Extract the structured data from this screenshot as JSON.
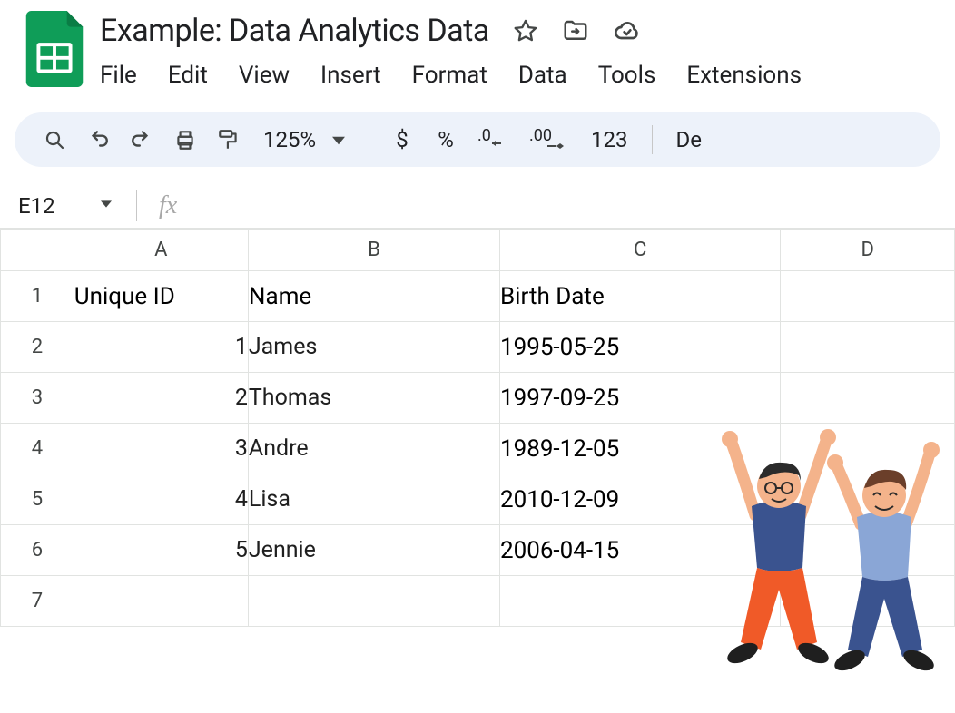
{
  "doc": {
    "title": "Example: Data Analytics Data"
  },
  "menu": [
    "File",
    "Edit",
    "View",
    "Insert",
    "Format",
    "Data",
    "Tools",
    "Extensions"
  ],
  "toolbar": {
    "zoom": "125%",
    "currency": "$",
    "percent": "%",
    "dec_dec": ".0",
    "inc_dec": ".00",
    "num_fmt": "123",
    "font_label": "De"
  },
  "namebox": {
    "cell_ref": "E12",
    "fx": "fx"
  },
  "columns": [
    "A",
    "B",
    "C",
    "D"
  ],
  "row_labels": [
    "1",
    "2",
    "3",
    "4",
    "5",
    "6",
    "7"
  ],
  "sheet": {
    "headers": {
      "a": "Unique ID",
      "b": "Name",
      "c": "Birth Date"
    },
    "rows": [
      {
        "id": "1",
        "name": "James",
        "birth": "1995-05-25"
      },
      {
        "id": "2",
        "name": "Thomas",
        "birth": "1997-09-25"
      },
      {
        "id": "3",
        "name": "Andre",
        "birth": "1989-12-05"
      },
      {
        "id": "4",
        "name": "Lisa",
        "birth": "2010-12-09"
      },
      {
        "id": "5",
        "name": "Jennie",
        "birth": "2006-04-15"
      }
    ]
  }
}
